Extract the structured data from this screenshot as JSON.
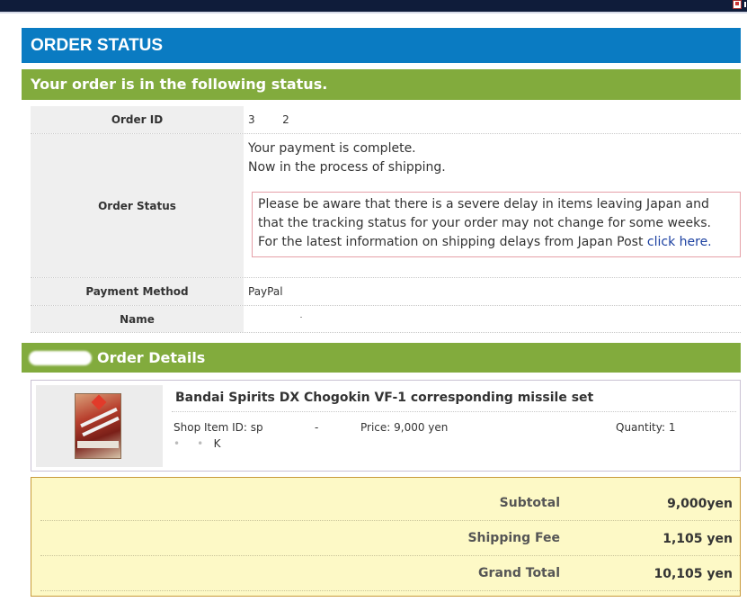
{
  "header": {
    "title": "ORDER STATUS",
    "subtitle": "Your order is in the following status."
  },
  "order": {
    "id_label": "Order ID",
    "id_value": "3        2",
    "status_label": "Order Status",
    "status_line1": "Your payment is complete.",
    "status_line2": "Now in the process of shipping.",
    "notice_line1": "Please be aware that there is a severe delay in items leaving Japan and",
    "notice_line2": "that the tracking status for your order may not change for some weeks.",
    "notice_line3": "For the latest information on shipping delays from Japan Post ",
    "notice_link": "click here.",
    "payment_label": "Payment Method",
    "payment_value": "PayPal",
    "name_label": "Name"
  },
  "details": {
    "heading": "Order Details",
    "item": {
      "title": "Bandai Spirits DX Chogokin VF-1 corresponding missile set",
      "shop_item_id": "Shop Item ID: sp",
      "dash": "-",
      "price": "Price: 9,000 yen",
      "quantity": "Quantity: 1",
      "code_suffix": "K"
    }
  },
  "totals": {
    "subtotal_label": "Subtotal",
    "subtotal_value": "9,000yen",
    "shipping_label": "Shipping Fee",
    "shipping_value": "1,105 yen",
    "grand_label": "Grand Total",
    "grand_value": "10,105 yen"
  },
  "icons": {
    "topbar": "home-icon",
    "thumbnail": "product-thumbnail"
  }
}
